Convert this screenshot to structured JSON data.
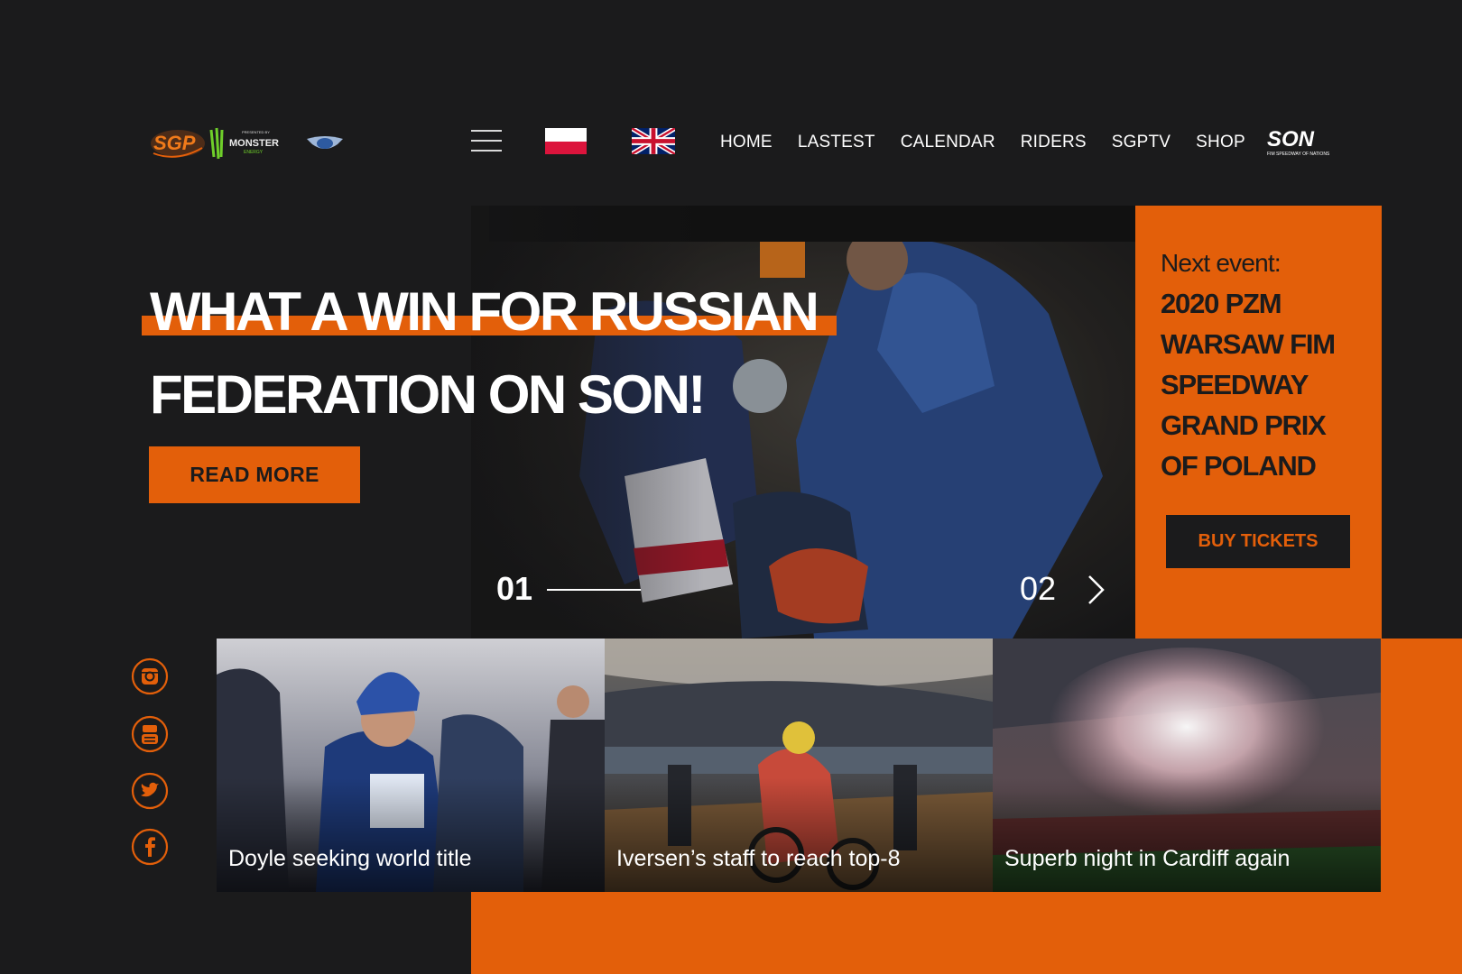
{
  "header": {
    "nav": [
      "HOME",
      "LASTEST",
      "CALENDAR",
      "RIDERS",
      "SGPTV",
      "SHOP"
    ],
    "logos": {
      "sgp": "SGP",
      "monster_top": "PRESENTED BY",
      "monster": "MONSTER",
      "monster_sub": "ENERGY",
      "son": "SON",
      "son_sub": "FIM SPEEDWAY OF NATIONS"
    }
  },
  "hero": {
    "headline_line1": "WHAT A WIN FOR RUSSIAN",
    "headline_line2": "FEDERATION ON SON!",
    "cta": "READ MORE",
    "slide_current": "01",
    "slide_next": "02"
  },
  "event": {
    "label": "Next event:",
    "name": "2020 PZM WARSAW FIM SPEEDWAY GRAND PRIX OF POLAND",
    "cta": "BUY TICKETS"
  },
  "news": [
    {
      "caption": "Doyle seeking world title"
    },
    {
      "caption": "Iversen’s staff to reach top-8"
    },
    {
      "caption": "Superb night in Cardiff again"
    }
  ],
  "social": [
    "instagram-icon",
    "youtube-icon",
    "twitter-icon",
    "facebook-icon"
  ],
  "colors": {
    "accent": "#e35f0a",
    "background": "#1b1b1c"
  }
}
